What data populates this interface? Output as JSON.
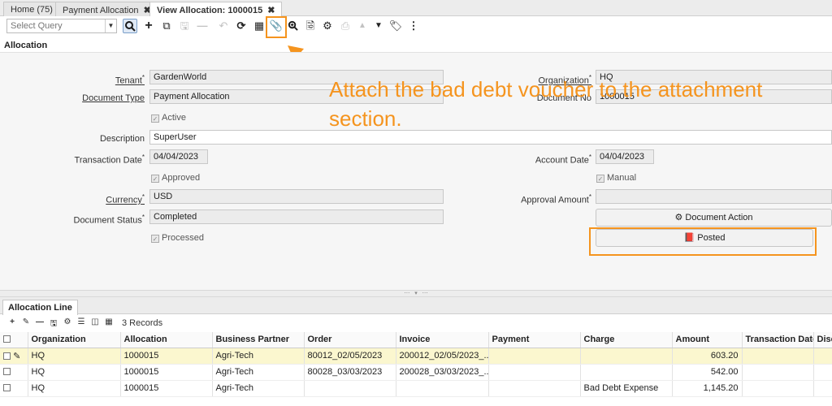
{
  "tabs": [
    {
      "label": "Home (75)",
      "closable": false
    },
    {
      "label": "Payment Allocation",
      "closable": true
    },
    {
      "label": "View Allocation: 1000015",
      "closable": true
    }
  ],
  "toolbar": {
    "query_placeholder": "Select Query",
    "icons": [
      "search-icon",
      "new-icon",
      "copy-icon",
      "save-icon",
      "delete-icon",
      "undo-icon",
      "refresh-icon",
      "grid-toggle-icon",
      "attachment-icon",
      "zoom-icon",
      "report-icon",
      "gear-icon",
      "print-icon",
      "up-icon",
      "down-icon",
      "tag-icon",
      "more-icon"
    ]
  },
  "section_title": "Allocation",
  "form": {
    "tenant": {
      "label": "Tenant",
      "value": "GardenWorld"
    },
    "organization": {
      "label": "Organization",
      "value": "HQ"
    },
    "document_type": {
      "label": "Document Type",
      "value": "Payment Allocation"
    },
    "document_no": {
      "label": "Document No",
      "value": "1000015"
    },
    "active": {
      "label": "Active",
      "checked": true
    },
    "description": {
      "label": "Description",
      "value": "SuperUser"
    },
    "transaction_date": {
      "label": "Transaction Date",
      "value": "04/04/2023"
    },
    "account_date": {
      "label": "Account Date",
      "value": "04/04/2023"
    },
    "approved": {
      "label": "Approved",
      "checked": true
    },
    "manual": {
      "label": "Manual",
      "checked": true
    },
    "currency": {
      "label": "Currency",
      "value": "USD"
    },
    "approval_amount": {
      "label": "Approval Amount",
      "value": ""
    },
    "document_status": {
      "label": "Document Status",
      "value": "Completed"
    },
    "processed": {
      "label": "Processed",
      "checked": true
    },
    "document_action_label": "Document Action",
    "posted_label": "Posted"
  },
  "annotation": {
    "line1": "Attach the bad debt voucher to the attachment",
    "line2": "section.",
    "color": "#f5941e"
  },
  "grid_tab": "Allocation Line",
  "records_label": "3 Records",
  "columns": [
    "Organization",
    "Allocation",
    "Business Partner",
    "Order",
    "Invoice",
    "Payment",
    "Charge",
    "Amount",
    "Transaction Date",
    "Disc"
  ],
  "rows": [
    {
      "organization": "HQ",
      "allocation": "1000015",
      "partner": "Agri-Tech",
      "order": "80012_02/05/2023",
      "invoice": "200012_02/05/2023_...",
      "payment": "",
      "charge": "",
      "amount": "603.20",
      "trx_date": "",
      "disc": ""
    },
    {
      "organization": "HQ",
      "allocation": "1000015",
      "partner": "Agri-Tech",
      "order": "80028_03/03/2023",
      "invoice": "200028_03/03/2023_...",
      "payment": "",
      "charge": "",
      "amount": "542.00",
      "trx_date": "",
      "disc": ""
    },
    {
      "organization": "HQ",
      "allocation": "1000015",
      "partner": "Agri-Tech",
      "order": "",
      "invoice": "",
      "payment": "",
      "charge": "Bad Debt Expense",
      "amount": "1,145.20",
      "trx_date": "",
      "disc": ""
    }
  ]
}
